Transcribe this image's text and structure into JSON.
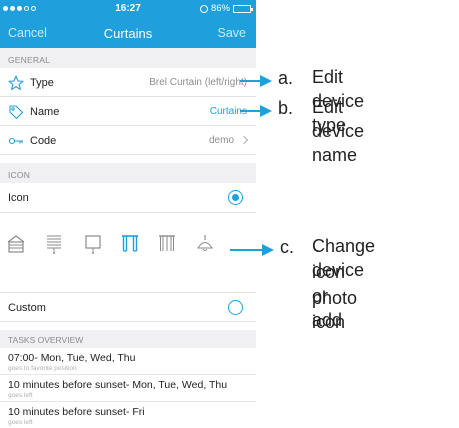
{
  "status_bar": {
    "time": "16:27",
    "battery": "86%"
  },
  "navbar": {
    "cancel": "Cancel",
    "title": "Curtains",
    "save": "Save"
  },
  "general_section": {
    "header": "GENERAL",
    "rows": [
      {
        "icon": "star-icon",
        "label": "Type",
        "value": "Brel Curtain (left/right)"
      },
      {
        "icon": "tag-icon",
        "label": "Name",
        "value": "Curtains"
      },
      {
        "icon": "key-icon",
        "label": "Code",
        "value": "demo"
      }
    ]
  },
  "icon_section": {
    "header": "ICON",
    "icon_label": "Icon",
    "icon_selected": true,
    "icons": [
      "awning-icon",
      "venetian-blind-icon",
      "roller-screen-icon",
      "curtain-icon",
      "curtain-outline-icon",
      "lamp-icon"
    ],
    "selected_icon_index": 3,
    "custom_label": "Custom",
    "custom_selected": false
  },
  "tasks_section": {
    "header": "TASKS OVERVIEW",
    "tasks": [
      {
        "title": "07:00- Mon, Tue, Wed, Thu",
        "subtitle": "goes to favorite position"
      },
      {
        "title": "10 minutes before sunset- Mon, Tue, Wed, Thu",
        "subtitle": "goes left"
      },
      {
        "title": "10 minutes before sunset- Fri",
        "subtitle": "goes left"
      }
    ]
  },
  "annotations": [
    {
      "letter": "a.",
      "text": "Edit device type"
    },
    {
      "letter": "b.",
      "text": "Edit device name"
    },
    {
      "letter": "c.",
      "text": "Change device icon or add photo icon",
      "lines": [
        "Change device",
        "icon or add",
        "photo icon"
      ]
    }
  ],
  "colors": {
    "accent": "#1fa0dc",
    "header_bg": "#f0f0f2",
    "muted_text": "#8e8e93"
  }
}
